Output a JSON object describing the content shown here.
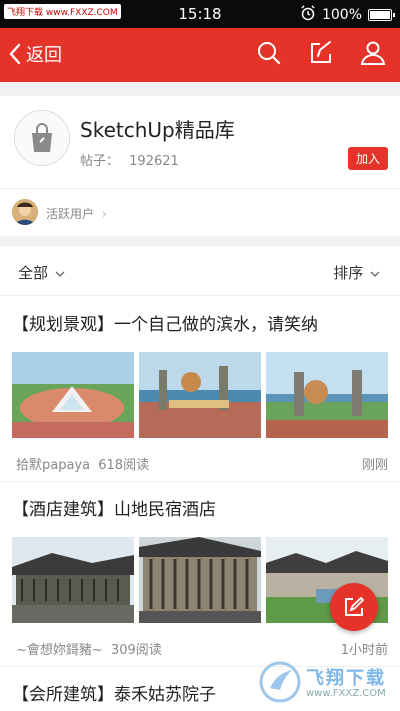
{
  "statusbar": {
    "watermark": "飞翔下载 www.FXXZ.COM",
    "carrier": "",
    "time": "15:18",
    "battery": "100%"
  },
  "navbar": {
    "back_label": "返回"
  },
  "forum": {
    "title": "SketchUp精品库",
    "posts_label": "帖子：",
    "posts_count": "192621",
    "join_label": "加入"
  },
  "active_users": {
    "label": "活跃用户"
  },
  "filter": {
    "left_label": "全部",
    "right_label": "排序"
  },
  "posts": [
    {
      "title": "【规划景观】一个自己做的滨水，请笑纳",
      "author": "拾默papaya",
      "reads": "618阅读",
      "time": "刚刚"
    },
    {
      "title": "【酒店建筑】山地民宿酒店",
      "author": "~會想妳鎶豬~",
      "reads": "309阅读",
      "time": "1小时前"
    },
    {
      "title": "【会所建筑】泰禾姑苏院子",
      "author": "",
      "reads": "",
      "time": ""
    }
  ],
  "watermark_bottom": {
    "text": "飞翔下载",
    "url": "www.FXXZ.COM"
  },
  "colors": {
    "accent": "#e5332a"
  }
}
